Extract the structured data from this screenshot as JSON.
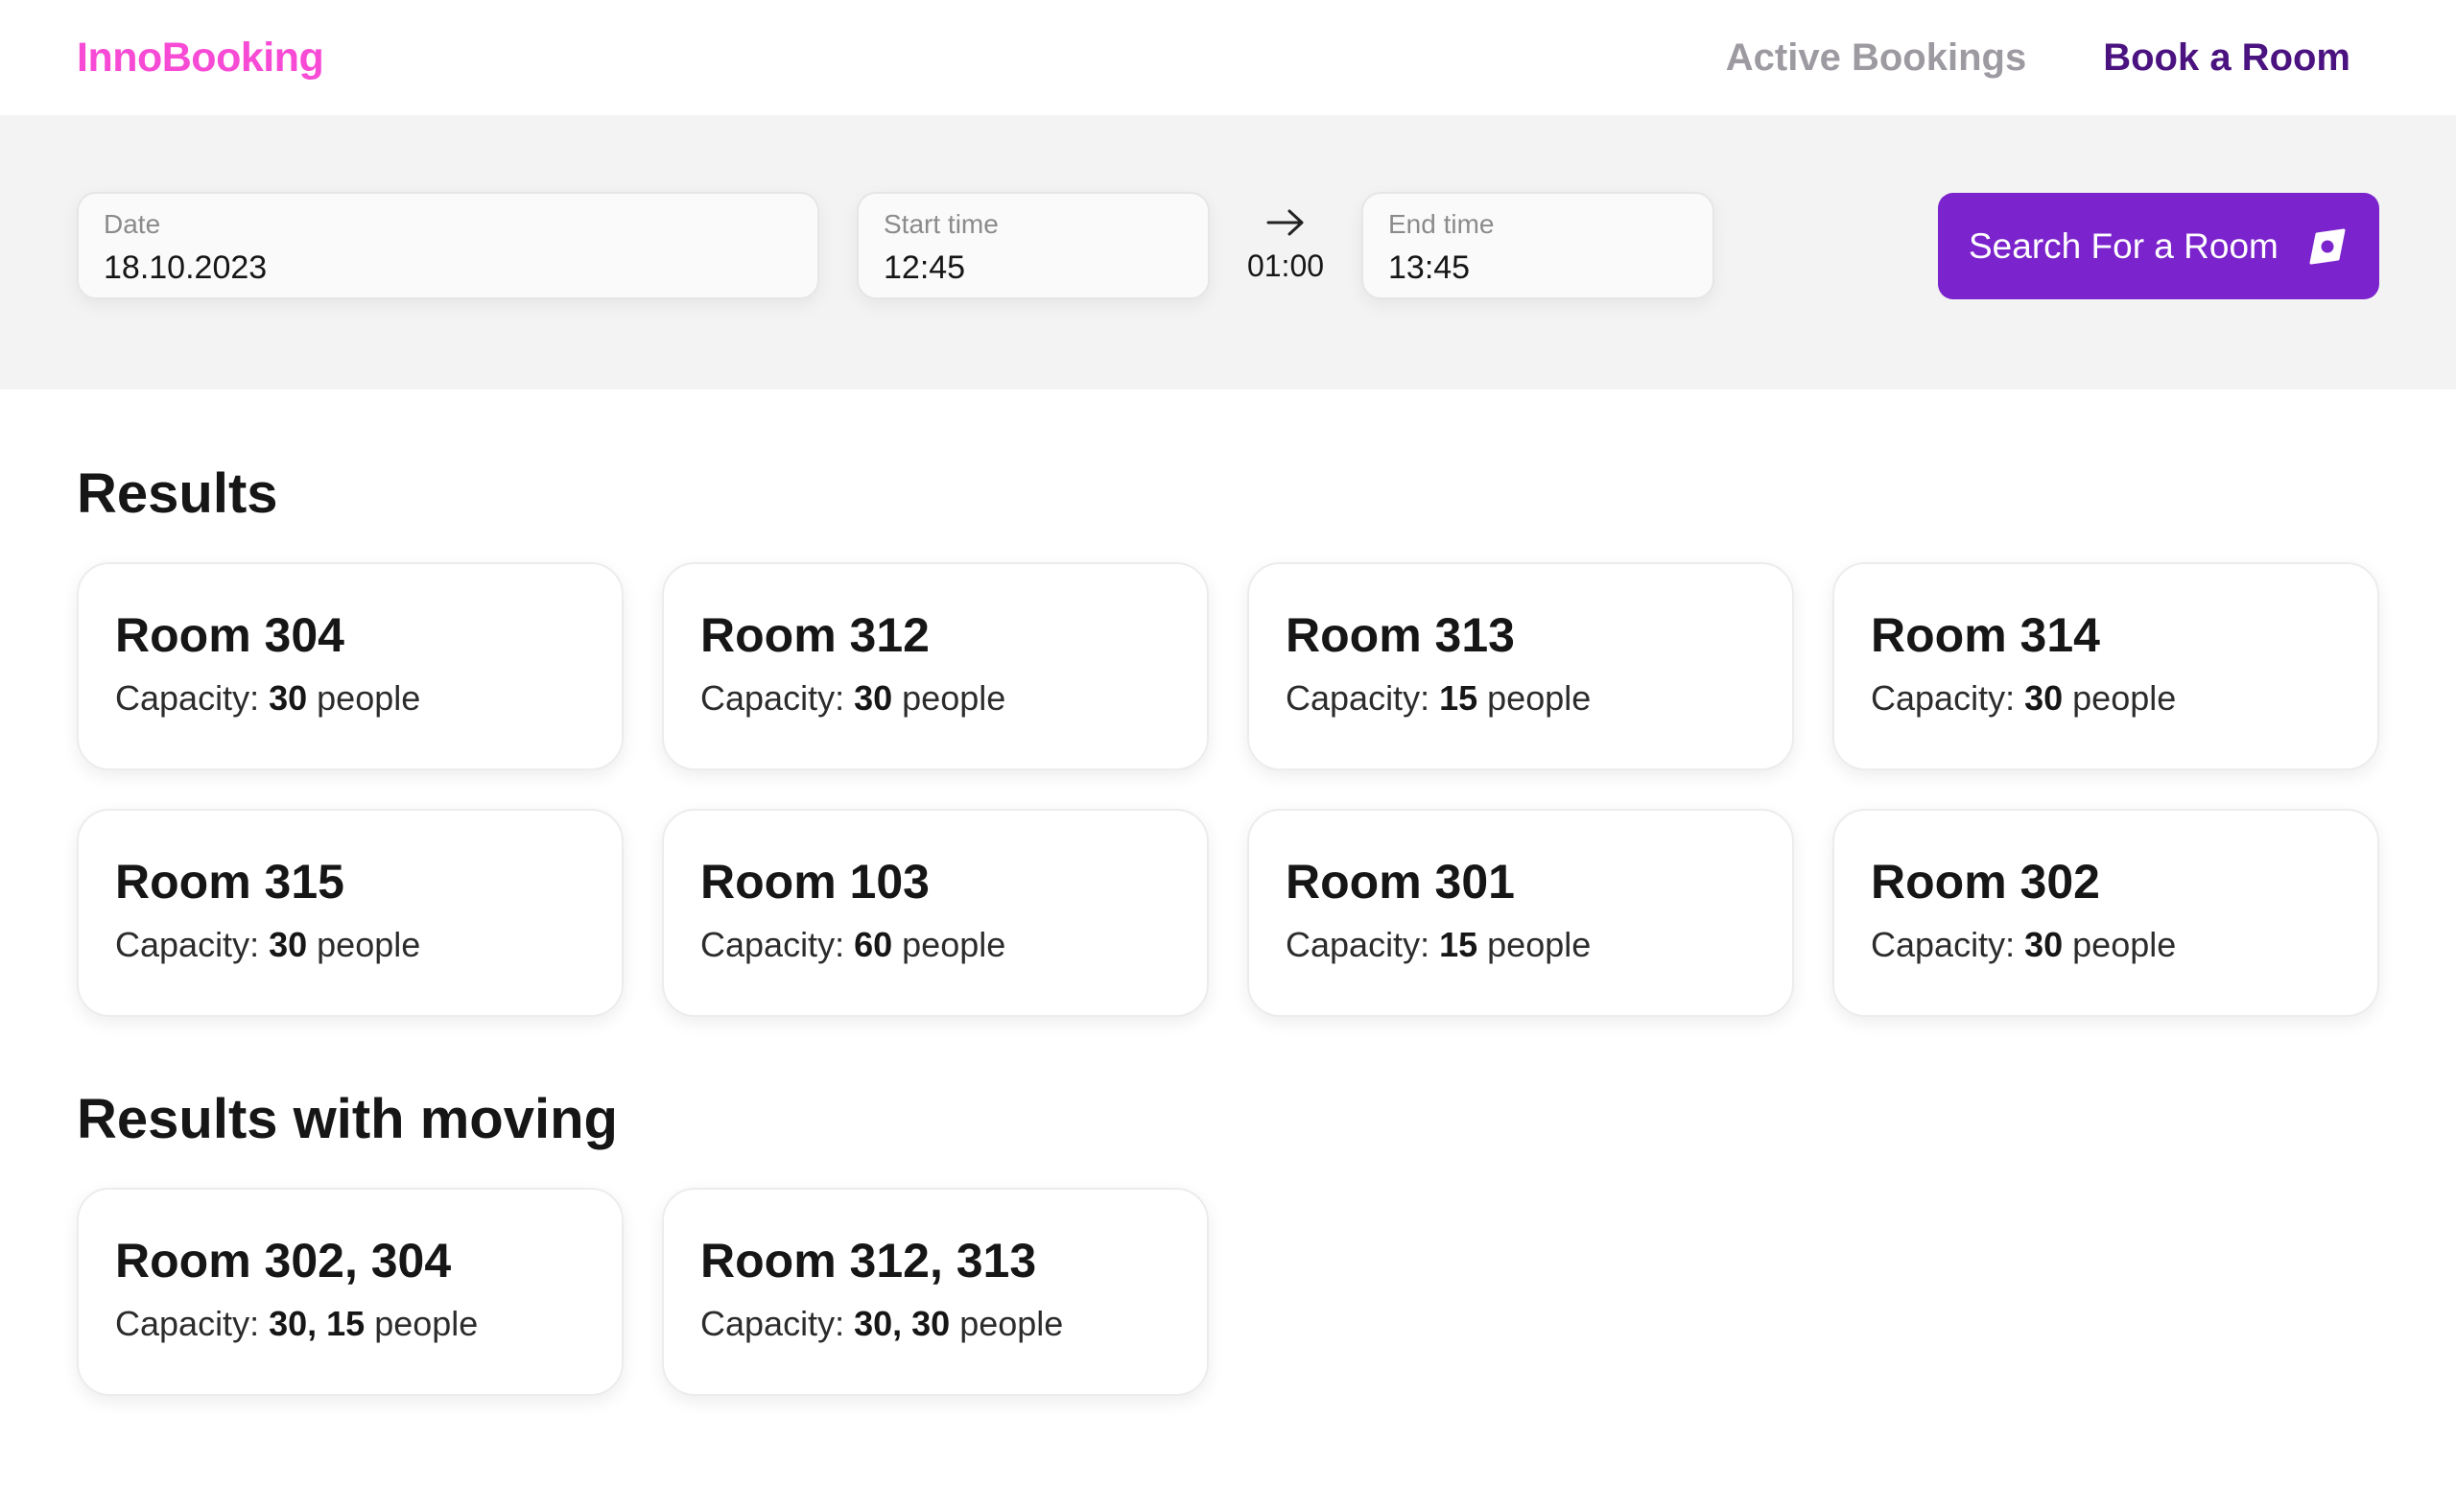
{
  "header": {
    "brand": "InnoBooking",
    "nav": {
      "active_bookings": "Active Bookings",
      "book_room": "Book a Room"
    }
  },
  "search": {
    "date": {
      "label": "Date",
      "value": "18.10.2023"
    },
    "start": {
      "label": "Start time",
      "value": "12:45"
    },
    "duration": "01:00",
    "end": {
      "label": "End time",
      "value": "13:45"
    },
    "button_label": "Search For a Room",
    "button_icon": "compass-icon"
  },
  "results": {
    "title": "Results",
    "rooms": [
      {
        "name": "Room 304",
        "cap_prefix": "Capacity:",
        "capacity": "30",
        "cap_suffix": "people"
      },
      {
        "name": "Room 312",
        "cap_prefix": "Capacity:",
        "capacity": "30",
        "cap_suffix": "people"
      },
      {
        "name": "Room 313",
        "cap_prefix": "Capacity:",
        "capacity": "15",
        "cap_suffix": "people"
      },
      {
        "name": "Room 314",
        "cap_prefix": "Capacity:",
        "capacity": "30",
        "cap_suffix": "people"
      },
      {
        "name": "Room 315",
        "cap_prefix": "Capacity:",
        "capacity": "30",
        "cap_suffix": "people"
      },
      {
        "name": "Room 103",
        "cap_prefix": "Capacity:",
        "capacity": "60",
        "cap_suffix": "people"
      },
      {
        "name": "Room 301",
        "cap_prefix": "Capacity:",
        "capacity": "15",
        "cap_suffix": "people"
      },
      {
        "name": "Room 302",
        "cap_prefix": "Capacity:",
        "capacity": "30",
        "cap_suffix": "people"
      }
    ]
  },
  "moving": {
    "title": "Results with moving",
    "rooms": [
      {
        "name": "Room 302, 304",
        "cap_prefix": "Capacity:",
        "capacity": "30, 15",
        "cap_suffix": "people"
      },
      {
        "name": "Room 312, 313",
        "cap_prefix": "Capacity:",
        "capacity": "30, 30",
        "cap_suffix": "people"
      }
    ]
  },
  "colors": {
    "brand": "#f74bd5",
    "nav_inactive": "#9d9aa1",
    "nav_active": "#4b1380",
    "button": "#7b23cc",
    "search_band": "#f3f3f3"
  }
}
